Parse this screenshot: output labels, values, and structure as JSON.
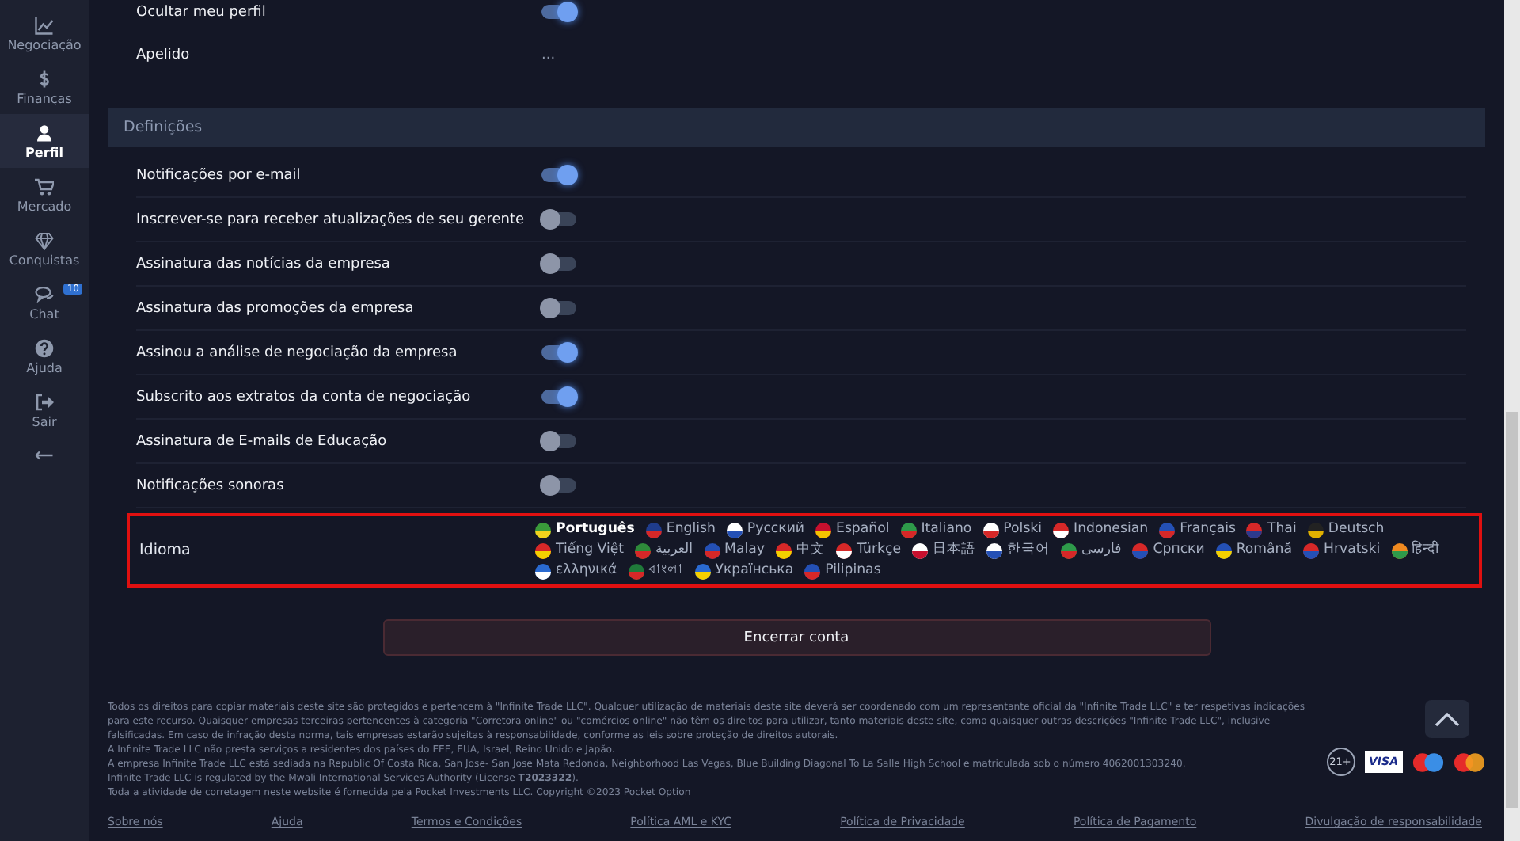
{
  "sidebar": {
    "items": [
      {
        "label": "Negociação",
        "selected": false
      },
      {
        "label": "Finanças",
        "selected": false
      },
      {
        "label": "Perfil",
        "selected": true
      },
      {
        "label": "Mercado",
        "selected": false
      },
      {
        "label": "Conquistas",
        "selected": false
      },
      {
        "label": "Chat",
        "selected": false,
        "badge": "10"
      },
      {
        "label": "Ajuda",
        "selected": false
      },
      {
        "label": "Sair",
        "selected": false
      }
    ]
  },
  "profile_rows": [
    {
      "label": "Ocultar meu perfil",
      "kind": "toggle",
      "on": true
    },
    {
      "label": "Apelido",
      "kind": "value",
      "value": "..."
    }
  ],
  "settings": {
    "title": "Definições",
    "toggles": [
      {
        "label": "Notificações por e-mail",
        "on": true
      },
      {
        "label": "Inscrever-se para receber atualizações de seu gerente",
        "on": false
      },
      {
        "label": "Assinatura das notícias da empresa",
        "on": false
      },
      {
        "label": "Assinatura das promoções da empresa",
        "on": false
      },
      {
        "label": "Assinou a análise de negociação da empresa",
        "on": true
      },
      {
        "label": "Subscrito aos extratos da conta de negociação",
        "on": true
      },
      {
        "label": "Assinatura de E-mails de Educação",
        "on": false
      },
      {
        "label": "Notificações sonoras",
        "on": false
      }
    ],
    "language": {
      "label": "Idioma",
      "options": [
        {
          "label": "Português",
          "selected": true
        },
        {
          "label": "English",
          "selected": false
        },
        {
          "label": "Русский",
          "selected": false
        },
        {
          "label": "Español",
          "selected": false
        },
        {
          "label": "Italiano",
          "selected": false
        },
        {
          "label": "Polski",
          "selected": false
        },
        {
          "label": "Indonesian",
          "selected": false
        },
        {
          "label": "Français",
          "selected": false
        },
        {
          "label": "Thai",
          "selected": false
        },
        {
          "label": "Deutsch",
          "selected": false
        },
        {
          "label": "Tiếng Việt",
          "selected": false
        },
        {
          "label": "العربية",
          "selected": false
        },
        {
          "label": "Malay",
          "selected": false
        },
        {
          "label": "中文",
          "selected": false
        },
        {
          "label": "Türkçe",
          "selected": false
        },
        {
          "label": "日本語",
          "selected": false
        },
        {
          "label": "한국어",
          "selected": false
        },
        {
          "label": "فارسی",
          "selected": false
        },
        {
          "label": "Српски",
          "selected": false
        },
        {
          "label": "Română",
          "selected": false
        },
        {
          "label": "Hrvatski",
          "selected": false
        },
        {
          "label": "हिन्दी",
          "selected": false
        },
        {
          "label": "ελληνικά",
          "selected": false
        },
        {
          "label": "বাংলা",
          "selected": false
        },
        {
          "label": "Українська",
          "selected": false
        },
        {
          "label": "Pilipinas",
          "selected": false
        }
      ]
    }
  },
  "close_account_button": "Encerrar conta",
  "footer": {
    "paragraphs": [
      "Todos os direitos para copiar materiais deste site são protegidos e pertencem à \"Infinite Trade LLC\". Qualquer utilização de materiais deste site deverá ser coordenado com um representante oficial da \"Infinite Trade LLC\" e ter respetivas indicações para este recurso. Quaisquer empresas terceiras pertencentes à categoria \"Corretora online\" ou \"comércios online\" não têm os direitos para utilizar, tanto materiais deste site, como quaisquer outras descrições \"Infinite Trade LLC\", inclusive falsificadas. Em caso de infração desta norma, tais empresas estarão sujeitas à responsabilidade, conforme as leis sobre proteção de direitos autorais.",
      "A Infinite Trade LLC não presta serviços a residentes dos países do EEE, EUA, Israel, Reino Unido e Japão.",
      "A empresa Infinite Trade LLC está sediada na Republic Of Costa Rica, San Jose- San Jose Mata Redonda, Neighborhood Las Vegas, Blue Building Diagonal To La Salle High School e matriculada sob o número 4062001303240.",
      "Infinite Trade LLC is regulated by the Mwali International Services Authority (License **T2023322**).",
      "Toda a atividade de corretagem neste website é fornecida pela Pocket Investments LLC. Copyright ©2023 Pocket Option"
    ],
    "age_badge": "21+",
    "card_label": "VISA",
    "links": [
      "Sobre nós",
      "Ajuda",
      "Termos e Condições",
      "Política AML e KYC",
      "Política de Privacidade",
      "Política de Pagamento",
      "Divulgação de responsabilidade"
    ]
  }
}
